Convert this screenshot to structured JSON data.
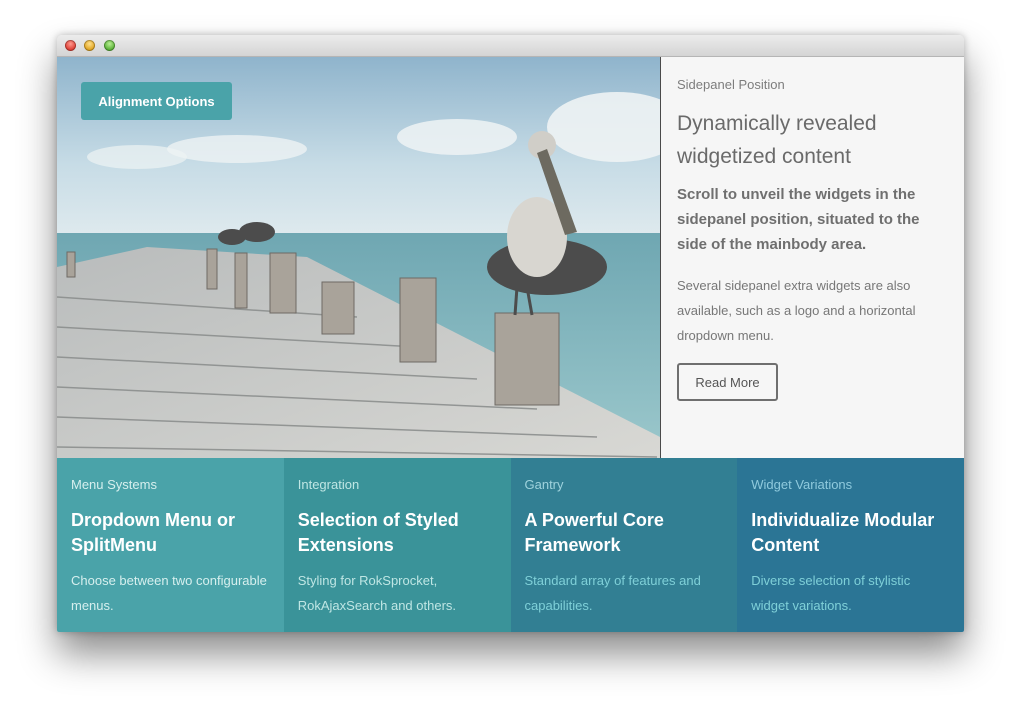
{
  "window": {
    "controls": [
      "close",
      "minimize",
      "maximize"
    ]
  },
  "hero": {
    "image_alt": "pelican on a wooden pier",
    "alignment_button": "Alignment Options"
  },
  "sidepanel": {
    "label": "Sidepanel Position",
    "heading": "Dynamically revealed widgetized content",
    "lead": "Scroll to unveil the widgets in the sidepanel position, situated to the side of the mainbody area.",
    "body": "Several sidepanel extra widgets are also available, such as a logo and a horizontal dropdown menu.",
    "read_more": "Read More"
  },
  "features": [
    {
      "label": "Menu Systems",
      "title": "Dropdown Menu or SplitMenu",
      "desc": "Choose between two configurable menus.",
      "bg": "#4aa3a9",
      "label_color": "#d6efee",
      "desc_color": "#d6efee"
    },
    {
      "label": "Integration",
      "title": "Selection of Styled Extensions",
      "desc": "Styling for RokSprocket, RokAjaxSearch and others.",
      "bg": "#3a9399",
      "label_color": "#bfe6e4",
      "desc_color": "#bfe6e4"
    },
    {
      "label": "Gantry",
      "title": "A Powerful Core Framework",
      "desc": "Standard array of features and capabilities.",
      "bg": "#327f93",
      "label_color": "#9fd3dd",
      "desc_color": "#7fd0d8"
    },
    {
      "label": "Widget Variations",
      "title": "Individualize Modular Content",
      "desc": "Diverse selection of stylistic widget variations.",
      "bg": "#2b7595",
      "label_color": "#8fcadd",
      "desc_color": "#7fd0d8"
    }
  ]
}
